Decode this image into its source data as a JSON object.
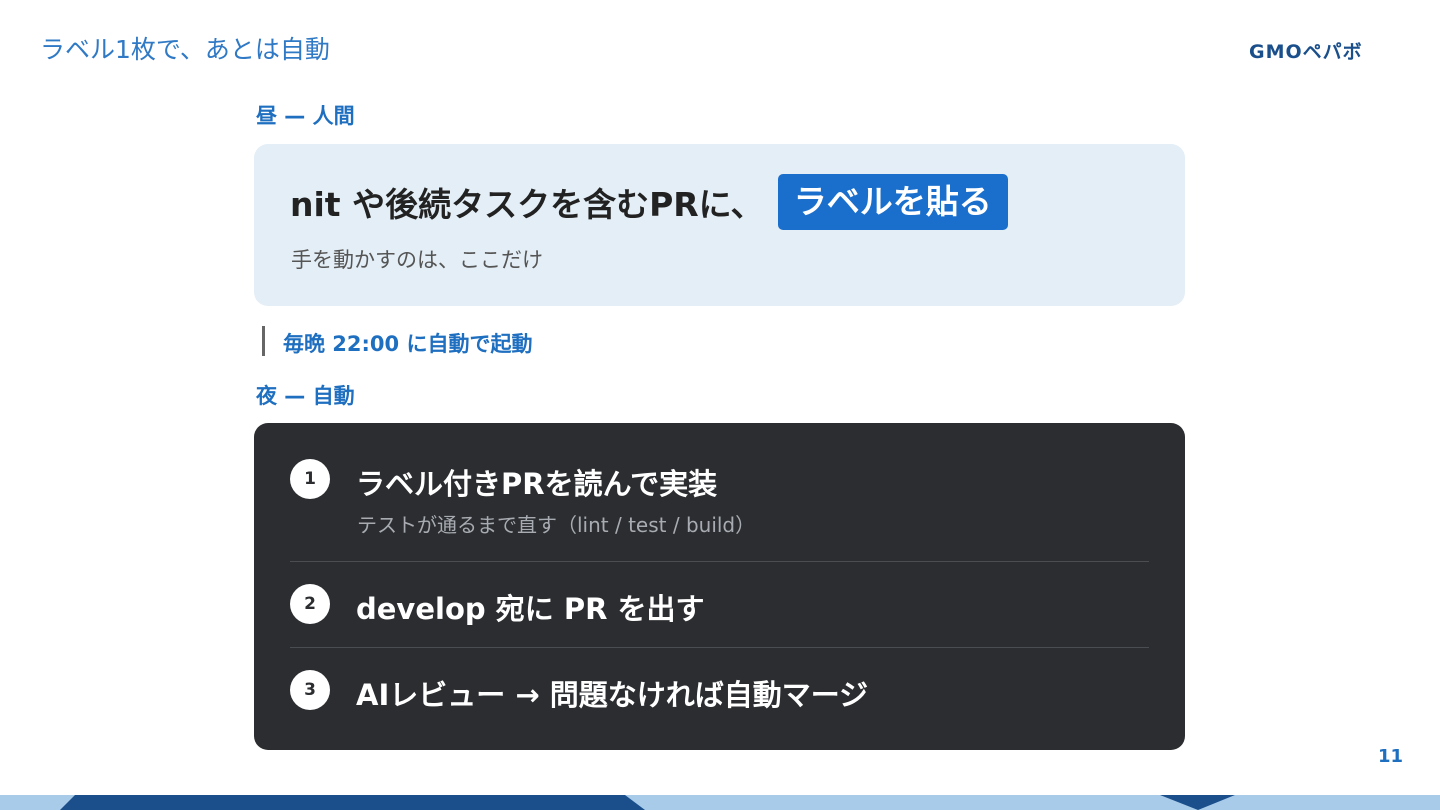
{
  "slide": {
    "title": "ラベル1枚で、あとは自動",
    "logo_text": "GMOペパボ",
    "page_number": "11"
  },
  "day": {
    "label": "昼 — 人間",
    "main_text": "nit や後続タスクを含むPRに、",
    "highlight": "ラベルを貼る",
    "sub_text": "手を動かすのは、ここだけ"
  },
  "trigger": {
    "text": "毎晩 22:00 に自動で起動"
  },
  "night": {
    "label": "夜 — 自動",
    "steps": [
      {
        "number": "1",
        "title": "ラベル付きPRを読んで実装",
        "subtitle": "テストが通るまで直す（lint / test / build）"
      },
      {
        "number": "2",
        "title": "develop 宛に PR を出す"
      },
      {
        "number": "3",
        "title": "AIレビュー → 問題なければ自動マージ"
      }
    ]
  },
  "colors": {
    "accent_blue": "#1f6fc0",
    "chip_blue": "#1a6fcc",
    "day_card_bg": "#e3eef6",
    "night_card_bg": "#2b2d30",
    "footer_light": "#a9cbea",
    "footer_dark": "#1a4f8b"
  }
}
